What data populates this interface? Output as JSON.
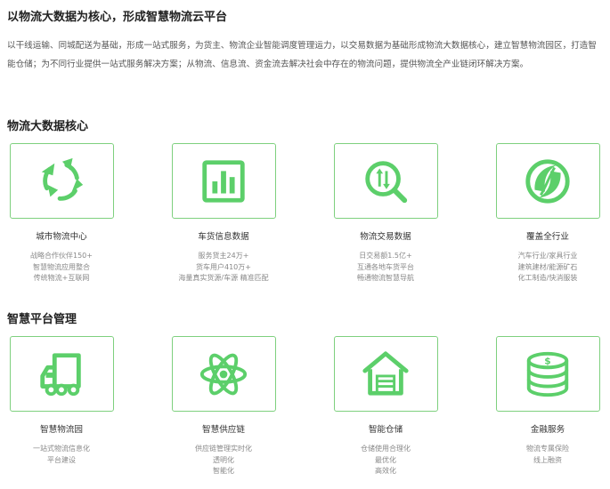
{
  "header": {
    "title": "以物流大数据为核心，形成智慧物流云平台",
    "intro": "以干线运输、同城配送为基础，形成一站式服务，为货主、物流企业智能调度管理运力，以交易数据为基础形成物流大数据核心，建立智慧物流园区，打造智能仓储；为不同行业提供一站式服务解决方案；从物流、信息流、资金流去解决社会中存在的物流问题，提供物流全产业链闭环解决方案。"
  },
  "accent_color": "#5ccf6a",
  "sections": [
    {
      "title": "物流大数据核心",
      "cards": [
        {
          "icon": "recycle-arrows-icon",
          "title": "城市物流中心",
          "lines": [
            "战略合作伙伴150+",
            "智慧物流应用整合",
            "传统物流+互联网"
          ]
        },
        {
          "icon": "bar-chart-icon",
          "title": "车货信息数据",
          "lines": [
            "服务货主24万+",
            "货车用户410万+",
            "海量真实货源/车源 精准匹配"
          ]
        },
        {
          "icon": "trade-search-icon",
          "title": "物流交易数据",
          "lines": [
            "日交易额1.5亿+",
            "互通各地车货平台",
            "畅通物流智慧导航"
          ]
        },
        {
          "icon": "globe-icon",
          "title": "覆盖全行业",
          "lines": [
            "汽车行业/家具行业",
            "建筑建材/能源矿石",
            "化工制造/快消服装"
          ]
        }
      ]
    },
    {
      "title": "智慧平台管理",
      "cards": [
        {
          "icon": "truck-icon",
          "title": "智慧物流园",
          "lines": [
            "一站式物流信息化",
            "平台建设"
          ]
        },
        {
          "icon": "atom-icon",
          "title": "智慧供应链",
          "lines": [
            "供应链管理实时化",
            "透明化",
            "智能化"
          ]
        },
        {
          "icon": "warehouse-icon",
          "title": "智能仓储",
          "lines": [
            "仓储使用合理化",
            "最优化",
            "高效化"
          ]
        },
        {
          "icon": "coins-icon",
          "title": "金融服务",
          "lines": [
            "物流专属保险",
            "线上融资"
          ]
        }
      ]
    }
  ]
}
